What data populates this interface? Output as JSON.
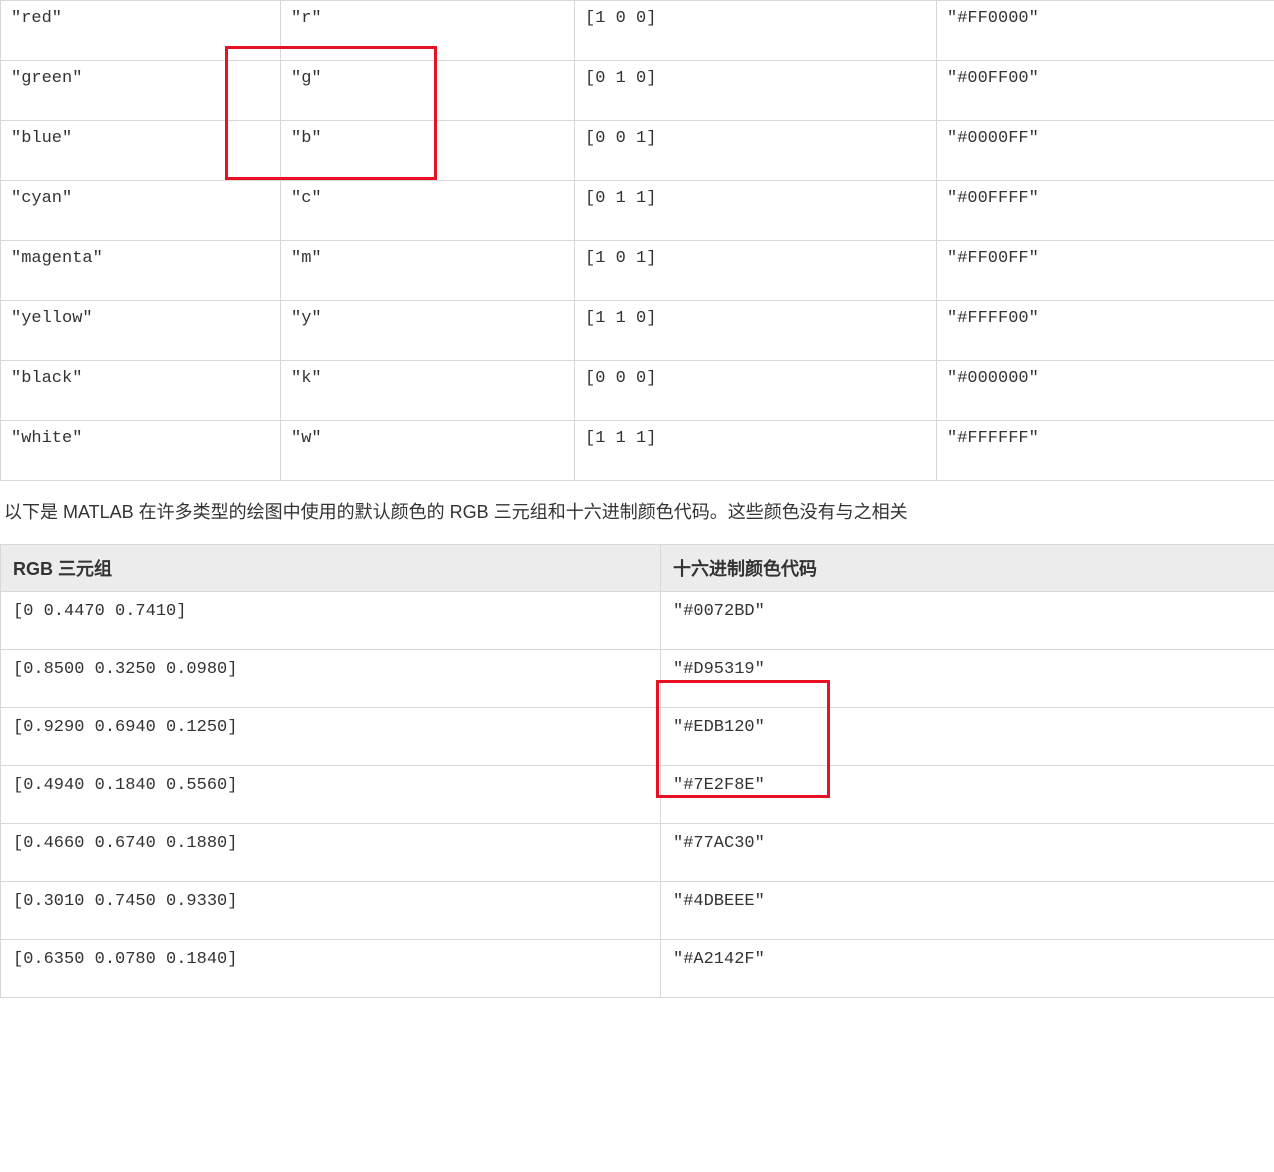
{
  "colors_table": {
    "rows": [
      {
        "name": "\"red\"",
        "short": "\"r\"",
        "rgb": "[1 0 0]",
        "hex": "\"#FF0000\""
      },
      {
        "name": "\"green\"",
        "short": "\"g\"",
        "rgb": "[0 1 0]",
        "hex": "\"#00FF00\""
      },
      {
        "name": "\"blue\"",
        "short": "\"b\"",
        "rgb": "[0 0 1]",
        "hex": "\"#0000FF\""
      },
      {
        "name": "\"cyan\"",
        "short": "\"c\"",
        "rgb": "[0 1 1]",
        "hex": "\"#00FFFF\""
      },
      {
        "name": "\"magenta\"",
        "short": "\"m\"",
        "rgb": "[1 0 1]",
        "hex": "\"#FF00FF\""
      },
      {
        "name": "\"yellow\"",
        "short": "\"y\"",
        "rgb": "[1 1 0]",
        "hex": "\"#FFFF00\""
      },
      {
        "name": "\"black\"",
        "short": "\"k\"",
        "rgb": "[0 0 0]",
        "hex": "\"#000000\""
      },
      {
        "name": "\"white\"",
        "short": "\"w\"",
        "rgb": "[1 1 1]",
        "hex": "\"#FFFFFF\""
      }
    ]
  },
  "paragraph": "以下是 MATLAB 在许多类型的绘图中使用的默认颜色的 RGB 三元组和十六进制颜色代码。这些颜色没有与之相关",
  "default_colors_table": {
    "headers": {
      "rgb": "RGB 三元组",
      "hex": "十六进制颜色代码"
    },
    "rows": [
      {
        "rgb": "[0 0.4470 0.7410]",
        "hex": "\"#0072BD\""
      },
      {
        "rgb": "[0.8500 0.3250 0.0980]",
        "hex": "\"#D95319\""
      },
      {
        "rgb": "[0.9290 0.6940 0.1250]",
        "hex": "\"#EDB120\""
      },
      {
        "rgb": "[0.4940 0.1840 0.5560]",
        "hex": "\"#7E2F8E\""
      },
      {
        "rgb": "[0.4660 0.6740 0.1880]",
        "hex": "\"#77AC30\""
      },
      {
        "rgb": "[0.3010 0.7450 0.9330]",
        "hex": "\"#4DBEEE\""
      },
      {
        "rgb": "[0.6350 0.0780 0.1840]",
        "hex": "\"#A2142F\""
      }
    ]
  }
}
